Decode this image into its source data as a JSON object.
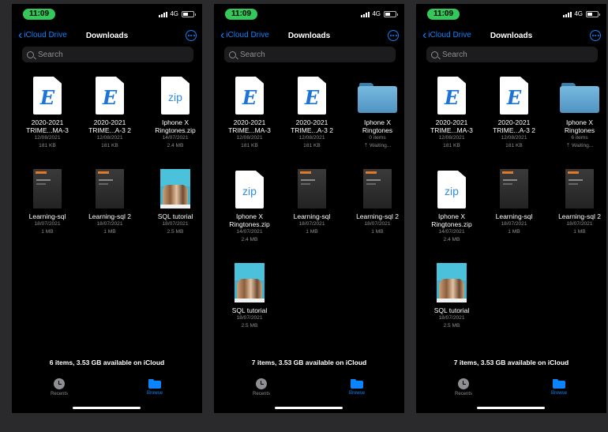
{
  "screens": [
    {
      "time": "11:09",
      "network": "4G",
      "back_label": "iCloud Drive",
      "title": "Downloads",
      "search_placeholder": "Search",
      "items": [
        {
          "thumb": "e-doc",
          "name1": "2020-2021",
          "name2": "TRIME...MA-3",
          "meta1": "12/08/2021",
          "meta2": "181 KB"
        },
        {
          "thumb": "e-doc",
          "name1": "2020-2021",
          "name2": "TRIME...A-3 2",
          "meta1": "12/08/2021",
          "meta2": "181 KB"
        },
        {
          "thumb": "zip",
          "zip_label": "zip",
          "name1": "Iphone X",
          "name2": "Ringtones.zip",
          "meta1": "14/07/2021",
          "meta2": "2.4 MB"
        },
        {
          "thumb": "book",
          "name1": "Learning-sql",
          "name2": "",
          "meta1": "18/07/2021",
          "meta2": "1 MB"
        },
        {
          "thumb": "book",
          "name1": "Learning-sql 2",
          "name2": "",
          "meta1": "18/07/2021",
          "meta2": "1 MB"
        },
        {
          "thumb": "photo",
          "name1": "SQL tutorial",
          "name2": "",
          "meta1": "18/07/2021",
          "meta2": "2.5 MB"
        }
      ],
      "footer": "6 items, 3.53 GB available on iCloud",
      "tabs": {
        "recents": "Recents",
        "browse": "Browse"
      }
    },
    {
      "time": "11:09",
      "network": "4G",
      "back_label": "iCloud Drive",
      "title": "Downloads",
      "search_placeholder": "Search",
      "items": [
        {
          "thumb": "e-doc",
          "name1": "2020-2021",
          "name2": "TRIME...MA-3",
          "meta1": "12/08/2021",
          "meta2": "181 KB"
        },
        {
          "thumb": "e-doc",
          "name1": "2020-2021",
          "name2": "TRIME...A-3 2",
          "meta1": "12/08/2021",
          "meta2": "181 KB"
        },
        {
          "thumb": "folder",
          "name1": "Iphone X",
          "name2": "Ringtones",
          "meta1": "0 items",
          "meta2": "⇡ Waiting..."
        },
        {
          "thumb": "zip",
          "zip_label": "zip",
          "name1": "Iphone X",
          "name2": "Ringtones.zip",
          "meta1": "14/07/2021",
          "meta2": "2.4 MB"
        },
        {
          "thumb": "book",
          "name1": "Learning-sql",
          "name2": "",
          "meta1": "18/07/2021",
          "meta2": "1 MB"
        },
        {
          "thumb": "book",
          "name1": "Learning-sql 2",
          "name2": "",
          "meta1": "18/07/2021",
          "meta2": "1 MB"
        },
        {
          "thumb": "photo",
          "name1": "SQL tutorial",
          "name2": "",
          "meta1": "18/07/2021",
          "meta2": "2.5 MB"
        }
      ],
      "footer": "7 items, 3.53 GB available on iCloud",
      "tabs": {
        "recents": "Recents",
        "browse": "Browse"
      }
    },
    {
      "time": "11:09",
      "network": "4G",
      "back_label": "iCloud Drive",
      "title": "Downloads",
      "search_placeholder": "Search",
      "items": [
        {
          "thumb": "e-doc",
          "name1": "2020-2021",
          "name2": "TRIME...MA-3",
          "meta1": "12/08/2021",
          "meta2": "181 KB"
        },
        {
          "thumb": "e-doc",
          "name1": "2020-2021",
          "name2": "TRIME...A-3 2",
          "meta1": "12/08/2021",
          "meta2": "181 KB"
        },
        {
          "thumb": "folder",
          "name1": "Iphone X",
          "name2": "Ringtones",
          "meta1": "6 items",
          "meta2": "⇡ Waiting..."
        },
        {
          "thumb": "zip",
          "zip_label": "zip",
          "name1": "Iphone X",
          "name2": "Ringtones.zip",
          "meta1": "14/07/2021",
          "meta2": "2.4 MB"
        },
        {
          "thumb": "book",
          "name1": "Learning-sql",
          "name2": "",
          "meta1": "18/07/2021",
          "meta2": "1 MB"
        },
        {
          "thumb": "book",
          "name1": "Learning-sql 2",
          "name2": "",
          "meta1": "18/07/2021",
          "meta2": "1 MB"
        },
        {
          "thumb": "photo",
          "name1": "SQL tutorial",
          "name2": "",
          "meta1": "18/07/2021",
          "meta2": "2.5 MB"
        }
      ],
      "footer": "7 items, 3.53 GB available on iCloud",
      "tabs": {
        "recents": "Recents",
        "browse": "Browse"
      }
    }
  ],
  "colors": {
    "accent": "#0a84ff",
    "status_pill": "#34c759",
    "background": "#000000",
    "search_bg": "#1c1c1e",
    "secondary_text": "#8e8e93"
  },
  "icons": [
    "search-icon",
    "chevron-left-icon",
    "more-icon",
    "clock-icon",
    "folder-icon",
    "signal-icon",
    "battery-icon"
  ]
}
